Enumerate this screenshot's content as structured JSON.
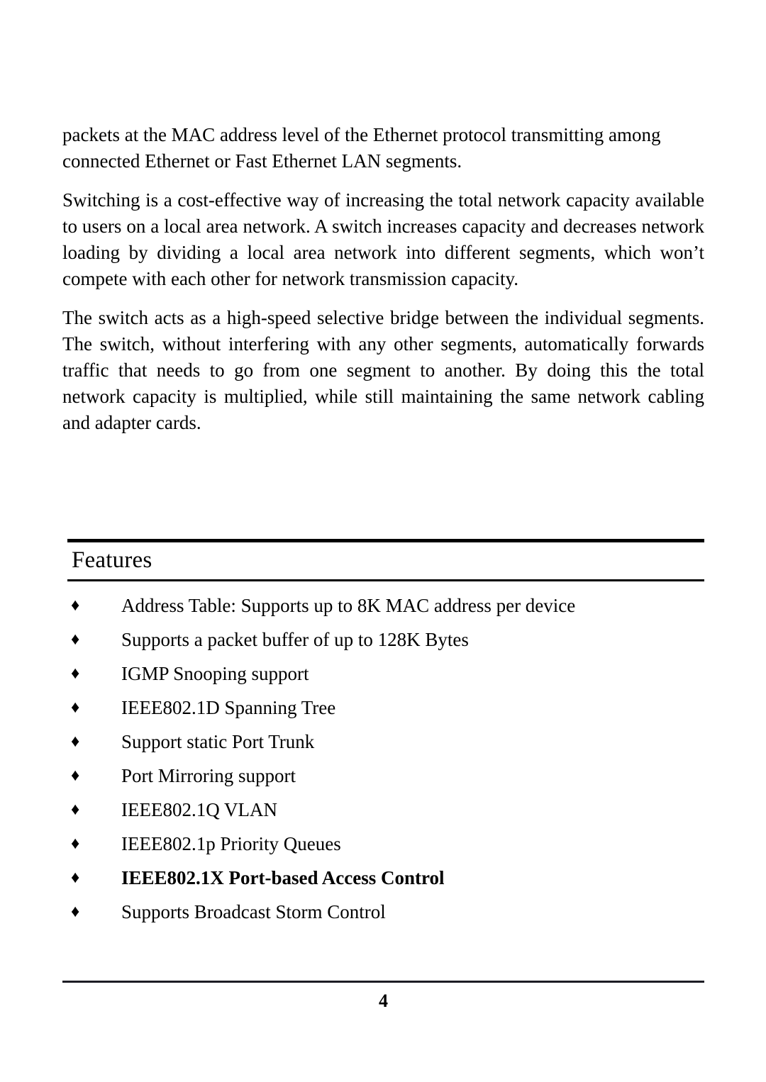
{
  "document": {
    "page_number": "4"
  },
  "body": {
    "paragraphs": [
      "packets at the MAC address level of the Ethernet protocol transmitting among connected Ethernet or Fast Ethernet LAN segments.",
      "Switching is a cost-effective way of increasing the total network capacity available to users on a local area network.  A switch increases capacity and decreases network loading by dividing a local area network into different segments, which won’t compete with each other for network transmission capacity.",
      "The switch acts as a high-speed selective bridge between the individual segments.  The switch, without interfering with any other segments, automatically forwards traffic that needs to go from one segment to another.  By doing this the total network capacity is multiplied, while still maintaining the same network cabling and adapter cards."
    ]
  },
  "section": {
    "title": "Features",
    "bullet_glyph": "♦",
    "items": [
      {
        "text": "Address Table: Supports up to 8K MAC address per device",
        "bold": false
      },
      {
        "text": "Supports a packet buffer of up to 128K Bytes",
        "bold": false
      },
      {
        "text": "IGMP Snooping support",
        "bold": false
      },
      {
        "text": "IEEE802.1D Spanning Tree",
        "bold": false
      },
      {
        "text": "Support static Port Trunk",
        "bold": false
      },
      {
        "text": "Port Mirroring support",
        "bold": false
      },
      {
        "text": "IEEE802.1Q VLAN",
        "bold": false
      },
      {
        "text": "IEEE802.1p Priority Queues",
        "bold": false
      },
      {
        "text": "IEEE802.1X Port-based Access Control",
        "bold": true
      },
      {
        "text": "Supports Broadcast Storm Control",
        "bold": false
      }
    ]
  },
  "colors": {
    "text": "#000000",
    "rule": "#000000",
    "footer_rule": "#1c1c24",
    "background": "#ffffff"
  }
}
